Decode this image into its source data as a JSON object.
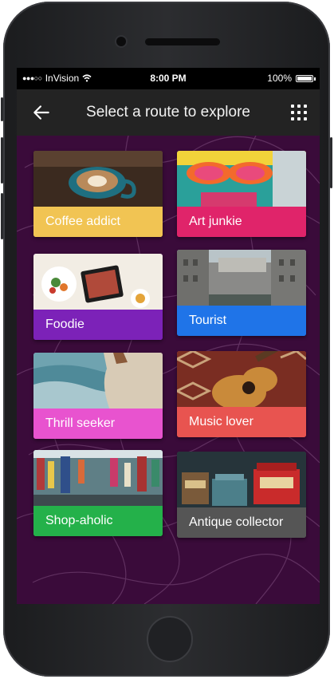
{
  "status_bar": {
    "carrier": "InVision",
    "time": "8:00 PM",
    "battery": "100%"
  },
  "app_bar": {
    "title": "Select a route to explore",
    "back_icon": "arrow-left-icon",
    "menu_icon": "grid-dots-icon"
  },
  "routes": [
    {
      "label": "Coffee addict",
      "color": "#f1c453",
      "photo": "latte-art"
    },
    {
      "label": "Art junkie",
      "color": "#e0246a",
      "photo": "graffiti-face"
    },
    {
      "label": "Foodie",
      "color": "#7c22b8",
      "photo": "food-tablet"
    },
    {
      "label": "Tourist",
      "color": "#1f74e8",
      "photo": "venice-canal"
    },
    {
      "label": "Thrill seeker",
      "color": "#e853cf",
      "photo": "ocean-cliff"
    },
    {
      "label": "Music lover",
      "color": "#e85450",
      "photo": "guitar"
    },
    {
      "label": "Shop-aholic",
      "color": "#24b14a",
      "photo": "shopping-street"
    },
    {
      "label": "Antique collector",
      "color": "#555555",
      "photo": "antique-tins"
    }
  ],
  "colors": {
    "screen_background": "#3a0b3a",
    "app_bar": "#232323"
  }
}
